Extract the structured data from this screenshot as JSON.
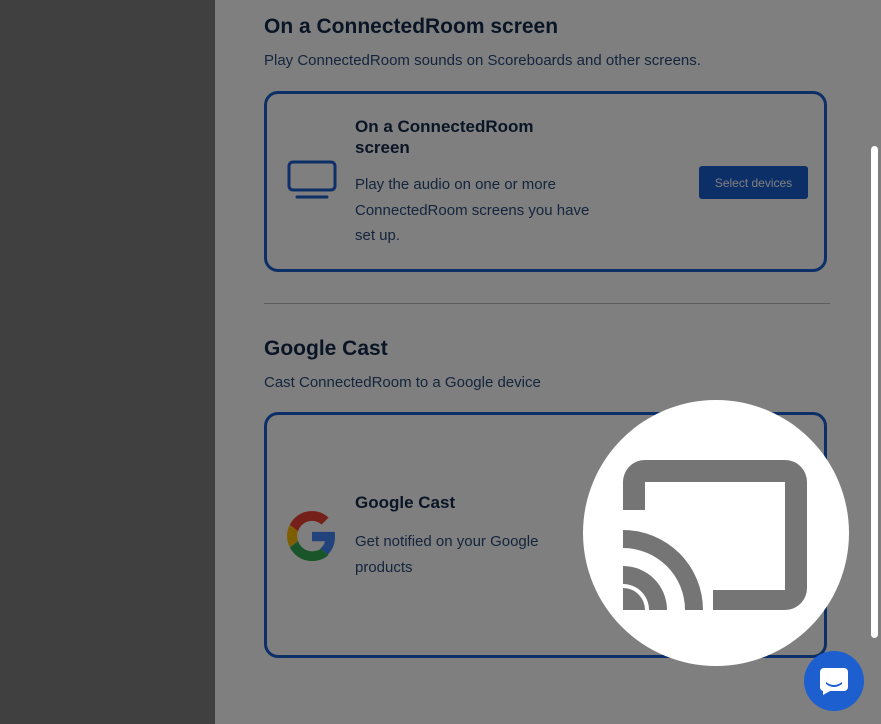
{
  "connected_room_section": {
    "title": "On a ConnectedRoom screen",
    "description": "Play ConnectedRoom sounds on Scoreboards and other screens.",
    "card": {
      "icon": "tv-icon",
      "title": "On a ConnectedRoom screen",
      "description": "Play the audio on one or more ConnectedRoom screens you have set up.",
      "button_label": "Select devices"
    }
  },
  "google_cast_section": {
    "title": "Google Cast",
    "description": "Cast ConnectedRoom to a Google device",
    "card": {
      "icon": "google-g-icon",
      "title": "Google Cast",
      "description": "Get notified on your Google products"
    }
  },
  "spotlight": {
    "icon": "cast-icon"
  },
  "chat": {
    "icon": "chat-bubble-icon"
  },
  "colors": {
    "accent": "#1b5fd1",
    "heading": "#13294b",
    "body_text": "#2a4a7a",
    "overlay": "rgba(0,0,0,0.5)"
  }
}
